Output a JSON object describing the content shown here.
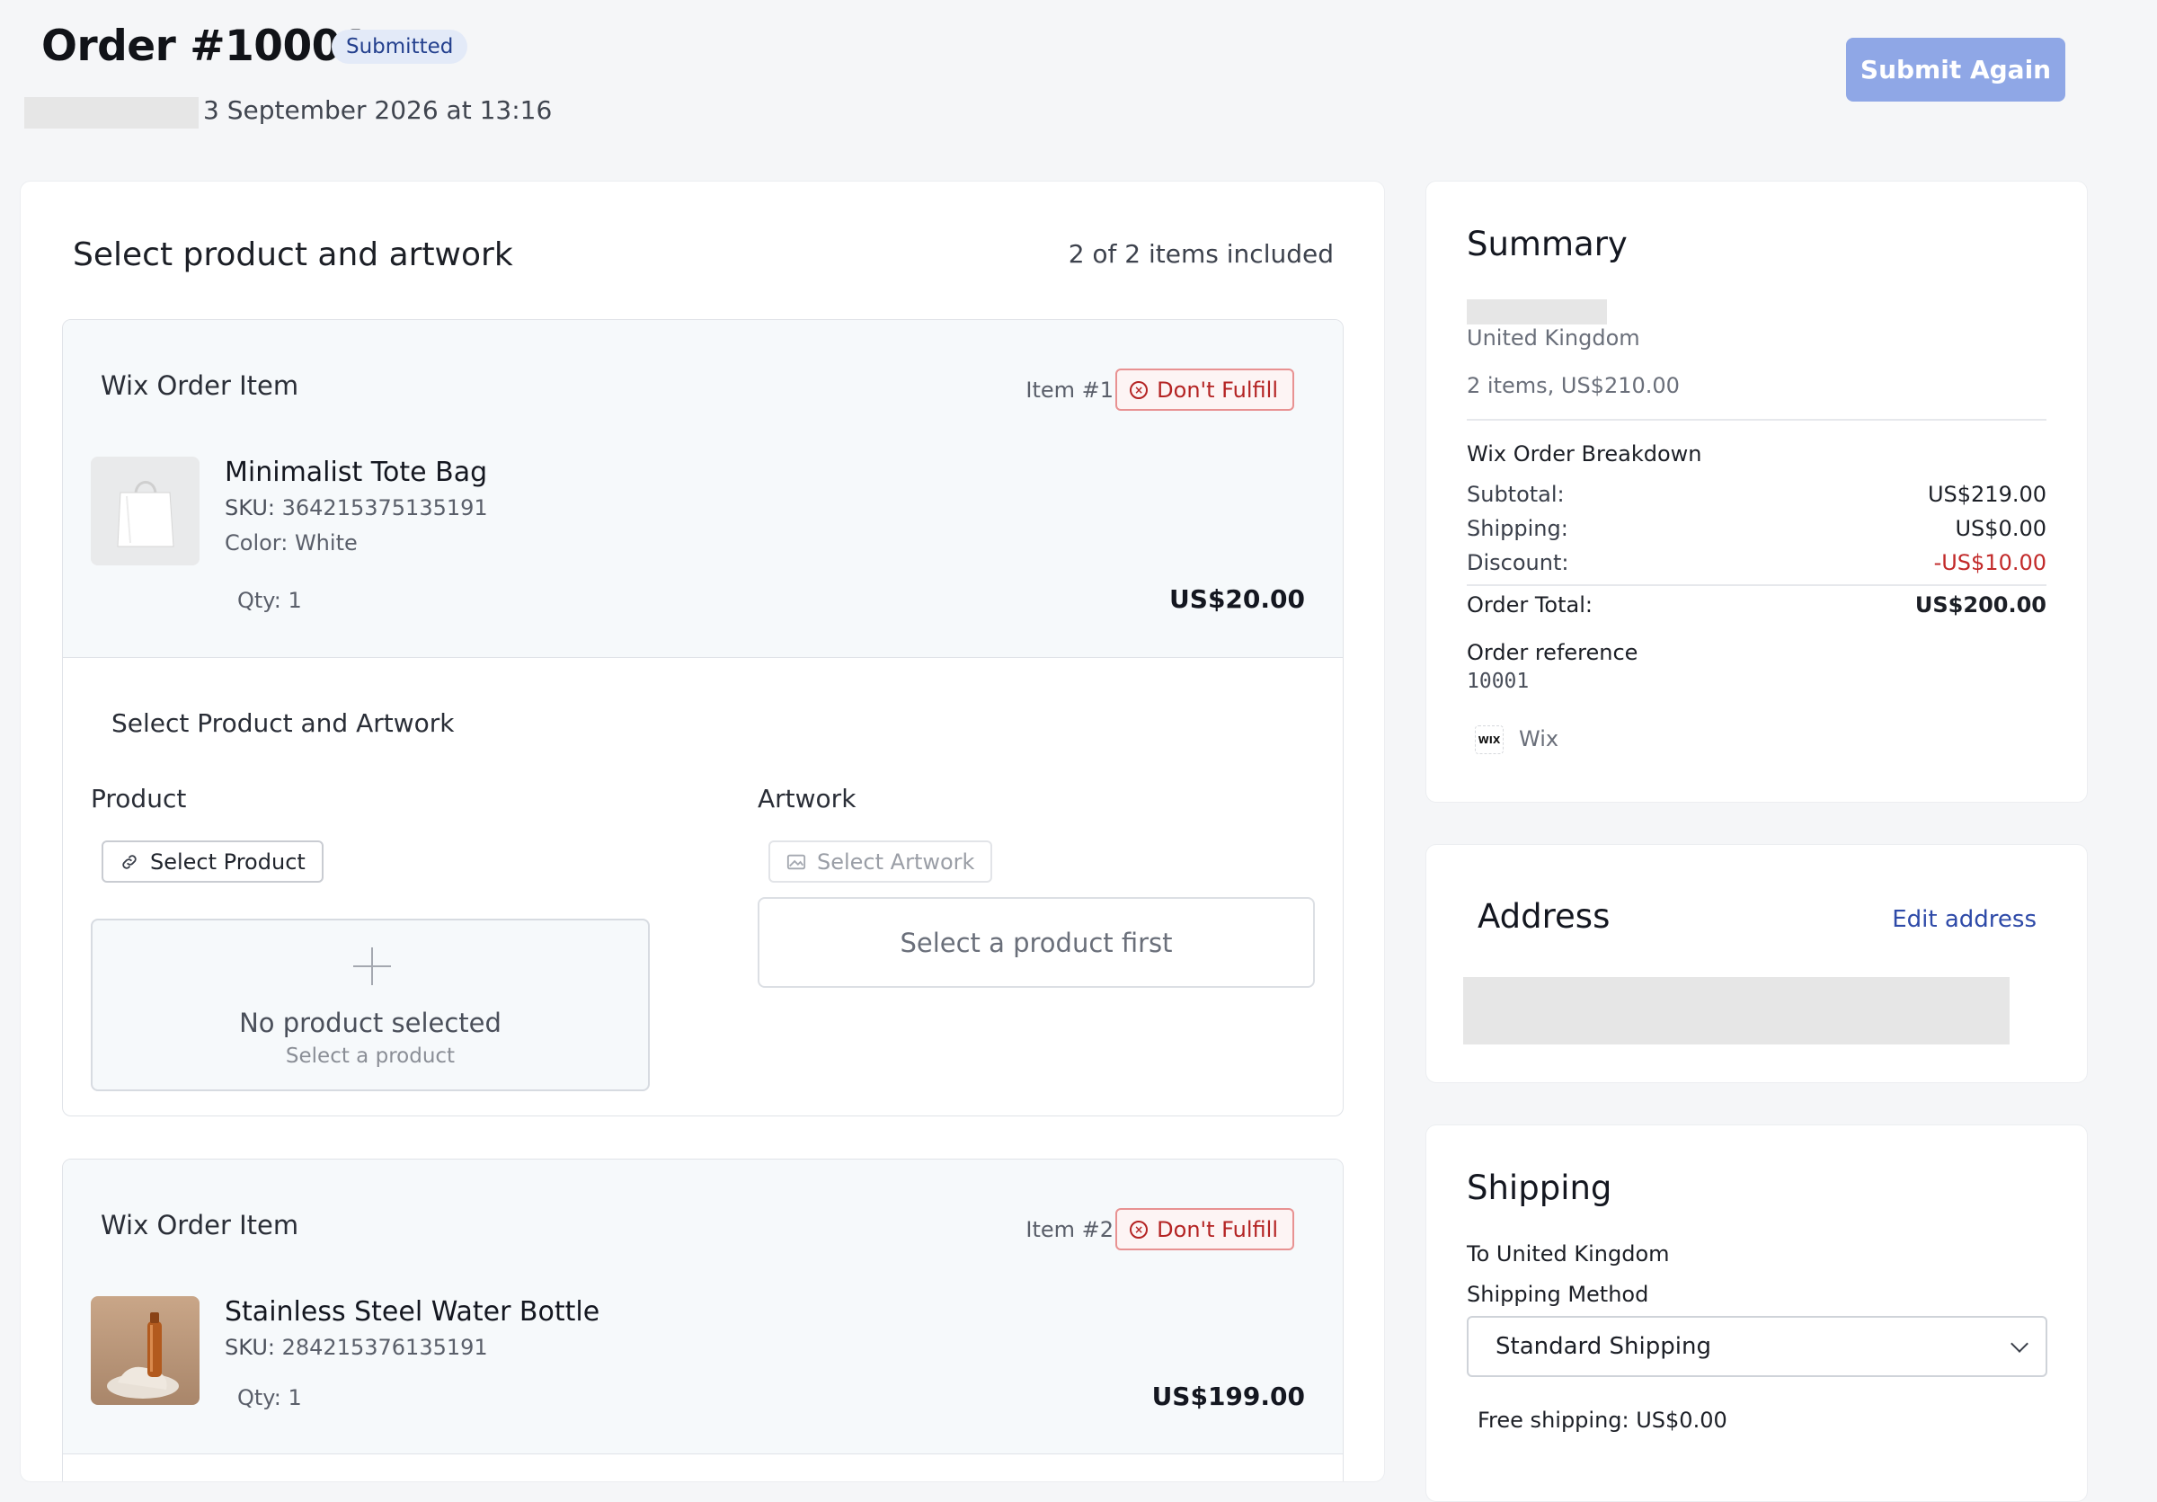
{
  "header": {
    "order_title": "Order #10001",
    "status": "Submitted",
    "order_date": "3 September 2026 at 13:16",
    "submit_again_label": "Submit Again"
  },
  "main": {
    "heading": "Select product and artwork",
    "items_count": "2 of 2 items included",
    "items": [
      {
        "kind": "Wix Order Item",
        "number": "Item #1",
        "dont_fulfill_label": "Don't Fulfill",
        "name": "Minimalist Tote Bag",
        "sku_label": "SKU:",
        "sku": "364215375135191",
        "color": "Color: White",
        "qty": "Qty: 1",
        "price": "US$20.00"
      },
      {
        "kind": "Wix Order Item",
        "number": "Item #2",
        "dont_fulfill_label": "Don't Fulfill",
        "name": "Stainless Steel Water Bottle",
        "sku_label": "SKU:",
        "sku": "284215376135191",
        "qty": "Qty: 1",
        "price": "US$199.00"
      }
    ],
    "select_section": {
      "title": "Select Product and Artwork",
      "product_label": "Product",
      "artwork_label": "Artwork",
      "select_product_button": "Select Product",
      "select_artwork_button": "Select Artwork",
      "empty_title": "No product selected",
      "empty_sub": "Select a product",
      "artwork_placeholder": "Select a product first"
    }
  },
  "summary": {
    "title": "Summary",
    "country": "United Kingdom",
    "items_total": "2 items, US$210.00",
    "breakdown_title": "Wix Order Breakdown",
    "rows": [
      {
        "label": "Subtotal:",
        "value": "US$219.00"
      },
      {
        "label": "Shipping:",
        "value": "US$0.00"
      },
      {
        "label": "Discount:",
        "value": "-US$10.00"
      }
    ],
    "total_label": "Order Total:",
    "total_value": "US$200.00",
    "reference_label": "Order reference",
    "reference_value": "10001",
    "channel_logo_text": "WIX",
    "channel_name": "Wix"
  },
  "address": {
    "title": "Address",
    "edit_label": "Edit address"
  },
  "shipping": {
    "title": "Shipping",
    "destination": "To United Kingdom",
    "method_label": "Shipping Method",
    "method_value": "Standard Shipping",
    "free_shipping": "Free shipping: US$0.00"
  },
  "colors": {
    "accent": "#8fa7e6",
    "danger": "#b42323",
    "link": "#2e4aa8",
    "badge_bg": "#e3eaf8"
  },
  "icons": [
    "x-circle-icon",
    "link-icon",
    "image-icon",
    "plus-icon",
    "chevron-down-icon",
    "wix-logo"
  ]
}
